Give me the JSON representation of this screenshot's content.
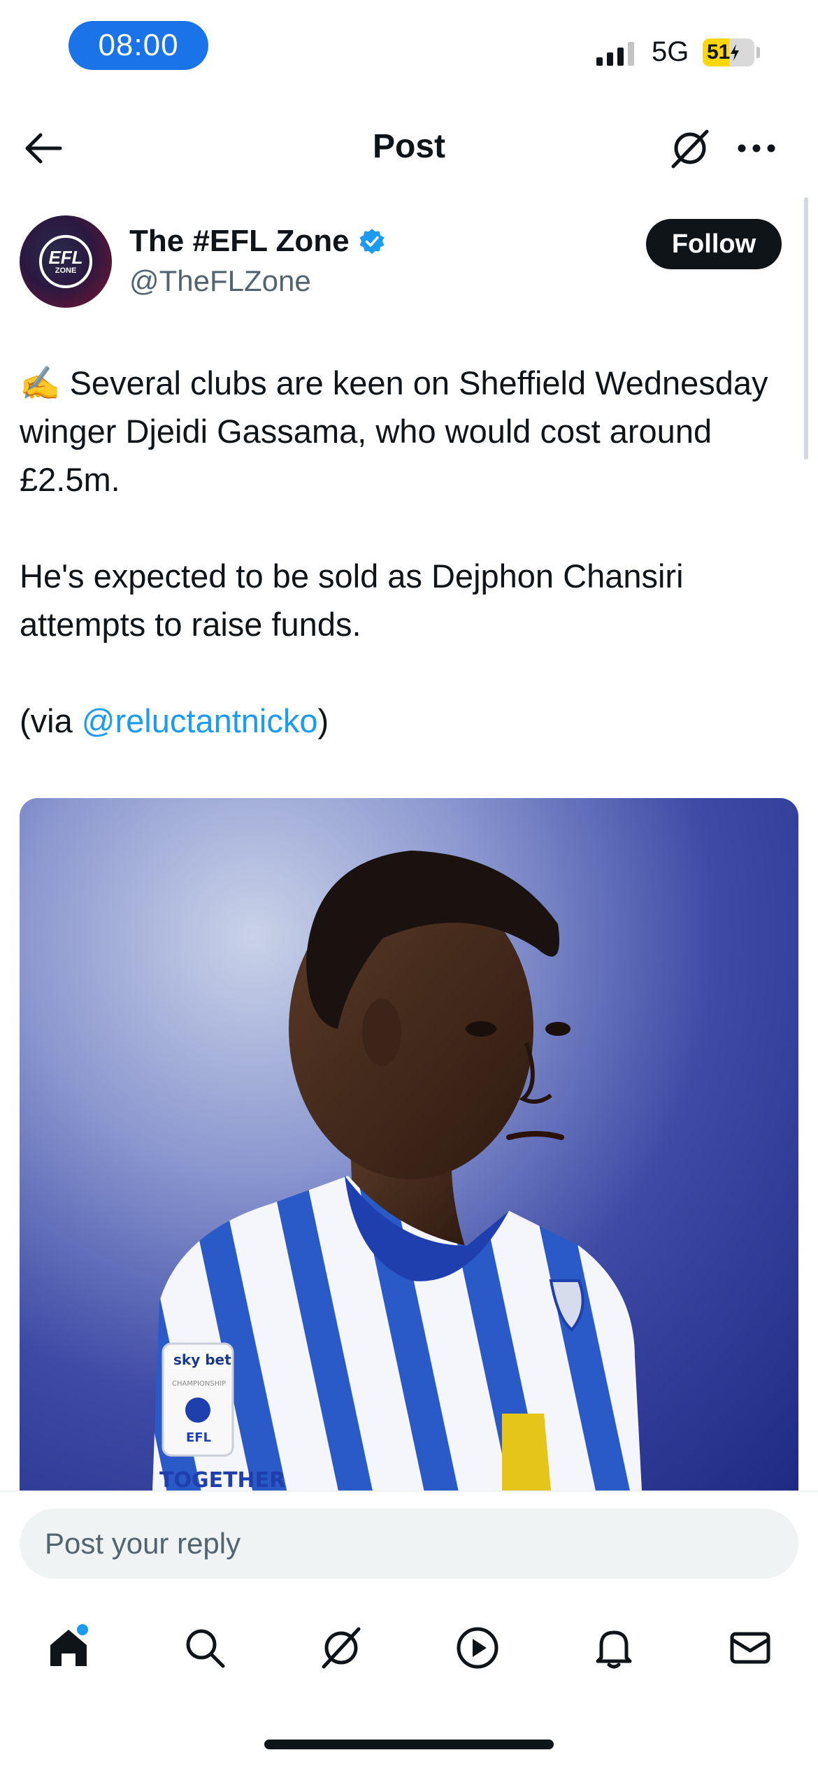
{
  "status_bar": {
    "time": "08:00",
    "network": "5G",
    "battery_percent": "51",
    "battery_level": 0.51,
    "signal_bars": 3
  },
  "header": {
    "title": "Post",
    "icons": [
      "back-arrow-icon",
      "grok-icon",
      "more-icon"
    ]
  },
  "post": {
    "author_name": "The #EFL Zone",
    "author_handle": "@TheFLZone",
    "verified": true,
    "avatar_text_main": "EFL",
    "avatar_text_sub": "ZONE",
    "follow_label": "Follow",
    "text_line1": "✍️ Several clubs are keen on Sheffield Wednesday winger Djeidi Gassama, who would cost around £2.5m.",
    "text_line2": "He's expected to be sold as Dejphon Chansiri attempts to raise funds.",
    "text_via_prefix": "(via ",
    "text_via_mention": "@reluctantnicko",
    "text_via_suffix": ")",
    "media_label": "Photo of player in blue and white striped kit",
    "media_badge_text": "sky bet",
    "media_badge_sub": "CHAMPIONSHIP",
    "media_badge_efl": "EFL",
    "media_shirt_text": "TOGETHER"
  },
  "reply": {
    "placeholder": "Post your reply"
  },
  "tab_bar": {
    "items": [
      {
        "name": "home",
        "icon": "home-icon",
        "has_dot": true
      },
      {
        "name": "search",
        "icon": "search-icon"
      },
      {
        "name": "grok",
        "icon": "grok-icon"
      },
      {
        "name": "video",
        "icon": "play-icon"
      },
      {
        "name": "notifications",
        "icon": "bell-icon"
      },
      {
        "name": "messages",
        "icon": "mail-icon"
      }
    ]
  },
  "colors": {
    "accent": "#1d9bf0",
    "time_pill": "#1a73e8",
    "text": "#0f1419",
    "secondary_text": "#536471"
  }
}
